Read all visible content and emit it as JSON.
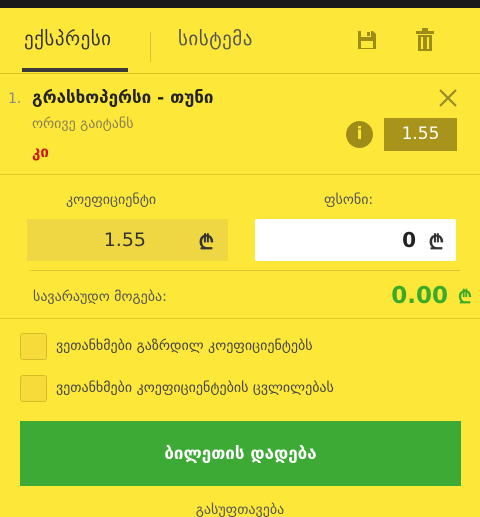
{
  "tabs": {
    "express": "ექსპრესი",
    "system": "სისტემა",
    "save_icon": "save-icon",
    "trash_icon": "trash-icon"
  },
  "bet": {
    "index": "1.",
    "title": "გრასხოპერსი - თუნი",
    "market": "ორივე გაიტანს",
    "selection": "კი",
    "odds": "1.55",
    "info": "i"
  },
  "slip": {
    "coef_label": "კოეფიციენტი",
    "stake_label": "ფსონი:",
    "coef_value": "1.55",
    "stake_value": "0",
    "currency": "₾",
    "win_label": "სავარაუდო მოგება:",
    "win_value": "0.00"
  },
  "options": {
    "accept_higher": "ვეთანხმები გაზრდილ კოეფიციენტებს",
    "accept_changes": "ვეთანხმები კოეფიციენტების ცვლილებას"
  },
  "actions": {
    "place_bet": "ბილეთის დადება",
    "clear": "გასუფთავება"
  },
  "colors": {
    "background": "#fde83a",
    "accent_green": "#3caa35",
    "selection_red": "#c81818",
    "odds_badge": "#a8941a"
  }
}
